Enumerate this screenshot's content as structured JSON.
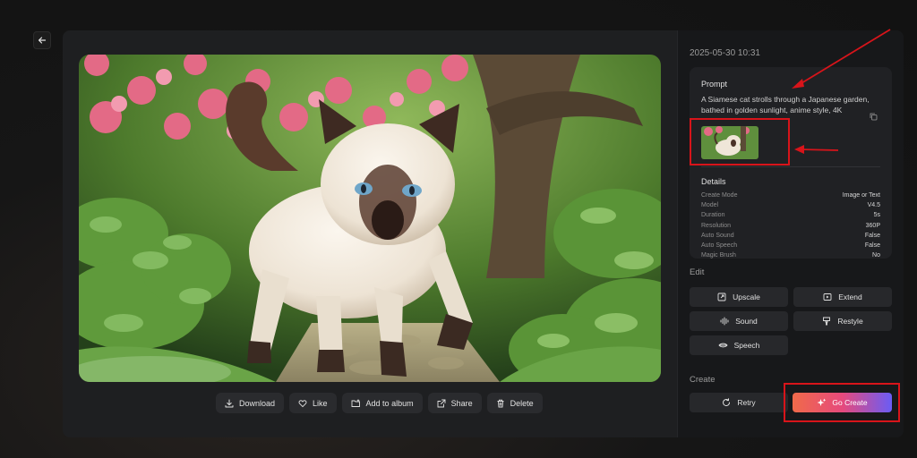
{
  "header": {
    "date": "2025-05-30 10:31"
  },
  "prompt": {
    "title": "Prompt",
    "text": "A Siamese cat strolls through a Japanese garden, bathed in golden sunlight, anime style, 4K"
  },
  "details": {
    "title": "Details",
    "rows": [
      {
        "key": "Create Mode",
        "value": "Image or Text"
      },
      {
        "key": "Model",
        "value": "V4.5"
      },
      {
        "key": "Duration",
        "value": "5s"
      },
      {
        "key": "Resolution",
        "value": "360P"
      },
      {
        "key": "Auto Sound",
        "value": "False"
      },
      {
        "key": "Auto Speech",
        "value": "False"
      },
      {
        "key": "Magic Brush",
        "value": "No"
      }
    ]
  },
  "edit": {
    "title": "Edit",
    "upscale": "Upscale",
    "extend": "Extend",
    "sound": "Sound",
    "restyle": "Restyle",
    "speech": "Speech"
  },
  "create": {
    "title": "Create",
    "retry": "Retry",
    "go_create": "Go Create"
  },
  "actions": {
    "download": "Download",
    "like": "Like",
    "add_to_album": "Add to album",
    "share": "Share",
    "delete": "Delete"
  },
  "icons": {
    "back": "arrow-left-icon",
    "copy": "copy-icon",
    "download": "download-icon",
    "like": "heart-icon",
    "album": "folder-plus-icon",
    "share": "share-icon",
    "delete": "trash-icon",
    "upscale": "upscale-icon",
    "extend": "extend-icon",
    "sound": "waveform-icon",
    "restyle": "brush-icon",
    "speech": "lips-icon",
    "retry": "refresh-icon",
    "go_create": "sparkle-icon"
  },
  "colors": {
    "accent_gradient_start": "#f06a4a",
    "accent_gradient_end": "#6a5cf5",
    "annotation": "#d8141a"
  }
}
